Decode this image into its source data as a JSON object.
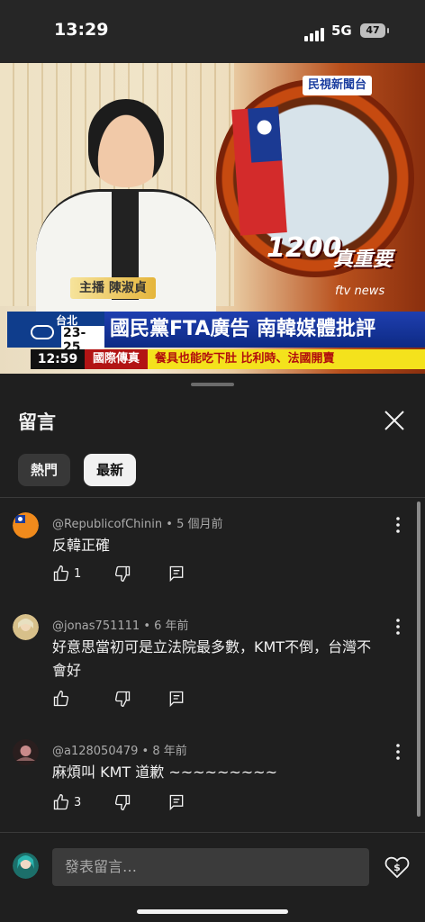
{
  "status_bar": {
    "time": "13:29",
    "network": "5G",
    "battery": "47"
  },
  "video": {
    "channel_logo": "民視新聞台",
    "time_slot": "1200",
    "brand": "真重要",
    "brand_sub": "ftv news",
    "anchor_label": "主播 陳淑貞",
    "weather_city": "台北",
    "weather_temp": "23-25",
    "headline": "國民黨FTA廣告 南韓媒體批評",
    "clock": "12:59",
    "category": "國際傳真",
    "ticker": "餐具也能吃下肚 比利時、法國開賣"
  },
  "comments_panel": {
    "title": "留言",
    "sort_tabs": [
      {
        "label": "熱門",
        "active": false
      },
      {
        "label": "最新",
        "active": true
      }
    ],
    "comments": [
      {
        "author": "@RepublicofChinin",
        "time": "5 個月前",
        "text": "反韓正確",
        "likes": "1",
        "avatar_color": "#f08a1c"
      },
      {
        "author": "@jonas751111",
        "time": "6 年前",
        "text": "好意思當初可是立法院最多數，KMT不倒，台灣不會好",
        "likes": "",
        "avatar_color": "#c9b07a"
      },
      {
        "author": "@a128050479",
        "time": "8 年前",
        "text": "麻煩叫 KMT 道歉 ~~~~~~~~~",
        "likes": "3",
        "avatar_color": "#6a4a4a"
      }
    ],
    "compose_placeholder": "發表留言…"
  },
  "colors": {
    "panel_bg": "#1f1f1f",
    "chip_active_bg": "#f1f1f1",
    "chip_bg": "#383838",
    "meta_text": "#aaaaaa"
  },
  "icons": [
    "thumb-up-icon",
    "thumb-down-icon",
    "reply-icon",
    "more-vert-icon",
    "close-icon",
    "super-thanks-icon"
  ]
}
